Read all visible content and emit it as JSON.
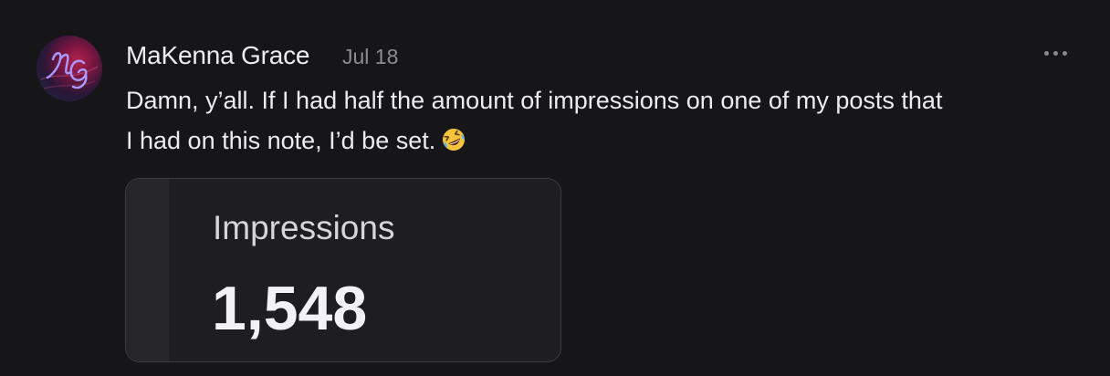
{
  "note": {
    "author": {
      "name": "MaKenna Grace",
      "avatar_icon": "mg-monogram-avatar",
      "avatar_colors": [
        "#b5234f",
        "#2a1736",
        "#5a4df0"
      ]
    },
    "date": "Jul 18",
    "menu_icon": "more-horizontal-icon",
    "body": {
      "line1": "Damn, y’all. If I had half the amount of impressions on one of my posts that",
      "line2": "I had on this note, I’d be set.",
      "emoji_icon": "rolling-on-the-floor-laughing-emoji"
    },
    "attachment": {
      "label": "Impressions",
      "value": "1,548"
    }
  },
  "theme": {
    "background": "#161618",
    "text": "#ececef",
    "muted": "#8c8c92",
    "card_border": "#3c3c40"
  }
}
